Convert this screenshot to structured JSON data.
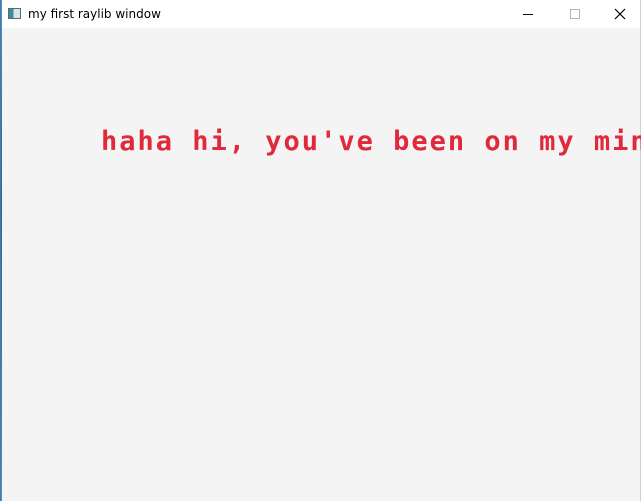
{
  "window": {
    "title": "my first raylib window",
    "controls": {
      "minimize_icon": "minimize-icon",
      "maximize_icon": "maximize-icon",
      "close_icon": "close-icon"
    }
  },
  "canvas": {
    "message": "haha hi, you've been on my mind",
    "background_color": "#f4f4f4",
    "text_color": "#e0293a"
  }
}
